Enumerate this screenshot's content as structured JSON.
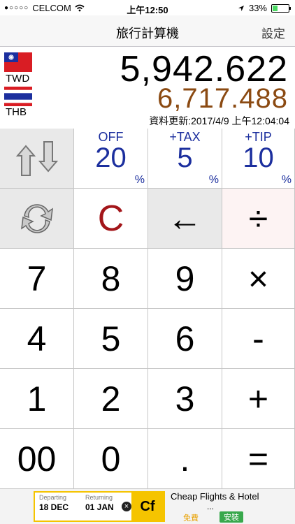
{
  "status": {
    "carrier": "CELCOM",
    "time": "上午12:50",
    "battery": "33%"
  },
  "nav": {
    "title": "旅行計算機",
    "settings": "設定"
  },
  "currency": {
    "from_code": "TWD",
    "to_code": "THB",
    "from_amount": "5,942.622",
    "to_amount": "6,717.488",
    "updated": "資料更新:2017/4/9 上午12:04:04"
  },
  "adjust": {
    "off_label": "OFF",
    "off_value": "20",
    "tax_label": "+TAX",
    "tax_value": "5",
    "tip_label": "+TIP",
    "tip_value": "10",
    "percent": "%"
  },
  "keys": {
    "clear": "C",
    "back": "←",
    "divide": "÷",
    "multiply": "×",
    "minus": "-",
    "plus": "+",
    "equals": "=",
    "dot": ".",
    "d7": "7",
    "d8": "8",
    "d9": "9",
    "d4": "4",
    "d5": "5",
    "d6": "6",
    "d1": "1",
    "d2": "2",
    "d3": "3",
    "d00": "00",
    "d0": "0"
  },
  "ad": {
    "departing_label": "Departing",
    "departing_date": "18 DEC",
    "returning_label": "Returning",
    "returning_date": "01 JAN",
    "logo": "Cf",
    "title": "Cheap Flights & Hotel",
    "ellipsis": "...",
    "free": "免費",
    "install": "安裝"
  },
  "colors": {
    "primary_amount": "#000000",
    "secondary_amount": "#8b4a12",
    "percent_blue": "#1c2f9e",
    "clear_red": "#a3161a"
  }
}
